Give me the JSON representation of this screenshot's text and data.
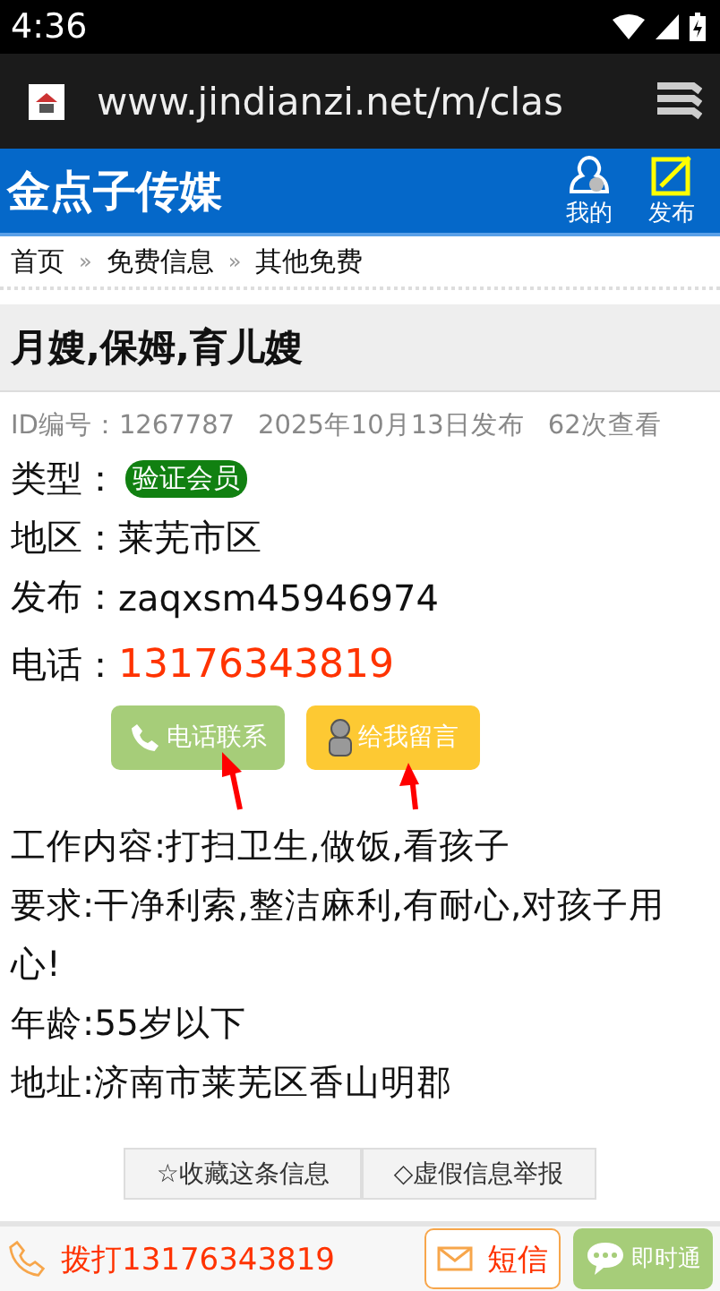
{
  "status_bar": {
    "time": "4:36"
  },
  "browser": {
    "url": "www.jindianzi.net/m/clas"
  },
  "header": {
    "logo": "金点子传媒",
    "actions": [
      {
        "kind": "user",
        "label": "我的"
      },
      {
        "kind": "post",
        "label": "发布"
      }
    ]
  },
  "breadcrumb": [
    "首页",
    "免费信息",
    "其他免费"
  ],
  "breadcrumb_separator": "»",
  "title": "月嫂,保姆,育儿嫂",
  "meta": [
    "ID编号：1267787",
    "2025年10月13日发布",
    "62次查看"
  ],
  "fields": [
    {
      "label": "类型：",
      "kind": "badge",
      "value": "验证会员"
    },
    {
      "label": "地区：",
      "kind": "text",
      "value": "莱芜市区"
    },
    {
      "label": "发布：",
      "kind": "text",
      "value": "zaqxsm45946974"
    },
    {
      "label": "电话：",
      "kind": "phone",
      "value": "13176343819"
    }
  ],
  "contact_buttons": [
    {
      "kind": "call",
      "label": "电话联系"
    },
    {
      "kind": "message",
      "label": "给我留言"
    }
  ],
  "content": [
    "工作内容:打扫卫生,做饭,看孩子",
    "要求:干净利索,整洁麻利,有耐心,对孩子用心!",
    "年龄:55岁以下",
    "地址:济南市莱芜区香山明郡"
  ],
  "tools": [
    "☆收藏这条信息",
    "◇虚假信息举报"
  ],
  "bottom_bar": {
    "call": "拨打13176343819",
    "sms": "短信",
    "chat": "即时通"
  }
}
